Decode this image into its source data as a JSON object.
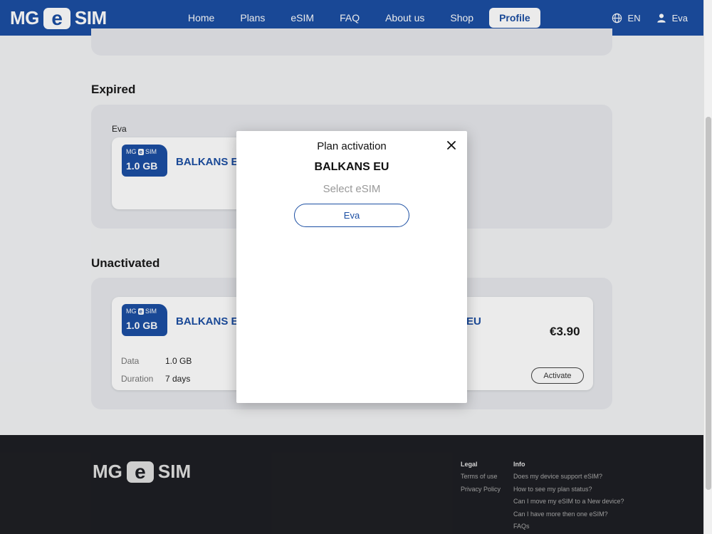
{
  "header": {
    "logo": {
      "left": "MG",
      "middle": "e",
      "right": "SIM"
    },
    "nav": [
      {
        "label": "Home",
        "active": false
      },
      {
        "label": "Plans",
        "active": false
      },
      {
        "label": "eSIM",
        "active": false
      },
      {
        "label": "FAQ",
        "active": false
      },
      {
        "label": "About us",
        "active": false
      },
      {
        "label": "Shop",
        "active": false
      },
      {
        "label": "Profile",
        "active": true
      }
    ],
    "language": "EN",
    "user": "Eva"
  },
  "sections": {
    "expired": {
      "title": "Expired",
      "owner": "Eva",
      "card": {
        "badge_logo": {
          "left": "MG",
          "middle": "e",
          "right": "SIM"
        },
        "data_badge": "1.0 GB",
        "plan_name": "BALKANS EU"
      }
    },
    "unactivated": {
      "title": "Unactivated",
      "card": {
        "badge_logo": {
          "left": "MG",
          "middle": "e",
          "right": "SIM"
        },
        "data_badge": "1.0 GB",
        "plan_name": "BALKANS EU",
        "plan_name_tail": "EU",
        "price": "€3.90",
        "data_label": "Data",
        "data_value": "1.0 GB",
        "duration_label": "Duration",
        "duration_value": "7 days",
        "activate_label": "Activate"
      }
    }
  },
  "modal": {
    "title": "Plan activation",
    "plan": "BALKANS EU",
    "subtitle": "Select eSIM",
    "options": [
      "Eva"
    ]
  },
  "footer": {
    "logo": {
      "left": "MG",
      "middle": "e",
      "right": "SIM"
    },
    "legal": {
      "heading": "Legal",
      "links": [
        "Terms of use",
        "Privacy Policy"
      ]
    },
    "info": {
      "heading": "Info",
      "links": [
        "Does my device support eSIM?",
        "How to see my plan status?",
        "Can I move my eSIM to a New device?",
        "Can I have more then one eSIM?",
        "FAQs"
      ]
    }
  },
  "colors": {
    "brand": "#1c4fa3",
    "footer_bg": "#1e1f24",
    "panel_bg": "#e6e8ec"
  }
}
